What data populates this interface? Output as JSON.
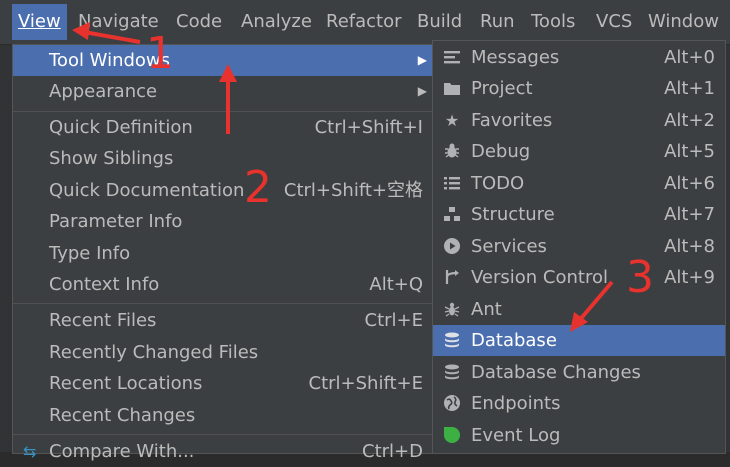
{
  "menubar": {
    "items": [
      "View",
      "Navigate",
      "Code",
      "Analyze",
      "Refactor",
      "Build",
      "Run",
      "Tools",
      "VCS",
      "Window"
    ]
  },
  "view_menu": {
    "items": [
      {
        "label": "Tool Windows",
        "shortcut": "",
        "submenu": true,
        "selected": true
      },
      {
        "label": "Appearance",
        "shortcut": "",
        "submenu": true
      },
      {
        "label": "Quick Definition",
        "shortcut": "Ctrl+Shift+I"
      },
      {
        "label": "Show Siblings",
        "shortcut": ""
      },
      {
        "label": "Quick Documentation",
        "shortcut": "Ctrl+Shift+空格"
      },
      {
        "label": "Parameter Info",
        "shortcut": ""
      },
      {
        "label": "Type Info",
        "shortcut": ""
      },
      {
        "label": "Context Info",
        "shortcut": "Alt+Q"
      },
      {
        "label": "Recent Files",
        "shortcut": "Ctrl+E"
      },
      {
        "label": "Recently Changed Files",
        "shortcut": ""
      },
      {
        "label": "Recent Locations",
        "shortcut": "Ctrl+Shift+E"
      },
      {
        "label": "Recent Changes",
        "shortcut": ""
      },
      {
        "label": "Compare With...",
        "shortcut": "Ctrl+D"
      }
    ]
  },
  "tool_windows_menu": {
    "items": [
      {
        "label": "Messages",
        "shortcut": "Alt+0",
        "icon": "messages-icon"
      },
      {
        "label": "Project",
        "shortcut": "Alt+1",
        "icon": "folder-icon"
      },
      {
        "label": "Favorites",
        "shortcut": "Alt+2",
        "icon": "star-icon"
      },
      {
        "label": "Debug",
        "shortcut": "Alt+5",
        "icon": "bug-icon"
      },
      {
        "label": "TODO",
        "shortcut": "Alt+6",
        "icon": "todo-list-icon"
      },
      {
        "label": "Structure",
        "shortcut": "Alt+7",
        "icon": "structure-icon"
      },
      {
        "label": "Services",
        "shortcut": "Alt+8",
        "icon": "services-play-icon"
      },
      {
        "label": "Version Control",
        "shortcut": "Alt+9",
        "icon": "version-control-icon"
      },
      {
        "label": "Ant",
        "shortcut": "",
        "icon": "ant-icon"
      },
      {
        "label": "Database",
        "shortcut": "",
        "icon": "database-icon",
        "selected": true
      },
      {
        "label": "Database Changes",
        "shortcut": "",
        "icon": "database-changes-icon"
      },
      {
        "label": "Endpoints",
        "shortcut": "",
        "icon": "globe-icon"
      },
      {
        "label": "Event Log",
        "shortcut": "",
        "icon": "event-log-icon"
      }
    ]
  },
  "annotations": {
    "n1": "1",
    "n2": "2",
    "n3": "3"
  },
  "colors": {
    "selection": "#4b6eaf",
    "menu_bg": "#3c3f41",
    "annotation": "#e8322d",
    "event_log_green": "#3cb043"
  }
}
